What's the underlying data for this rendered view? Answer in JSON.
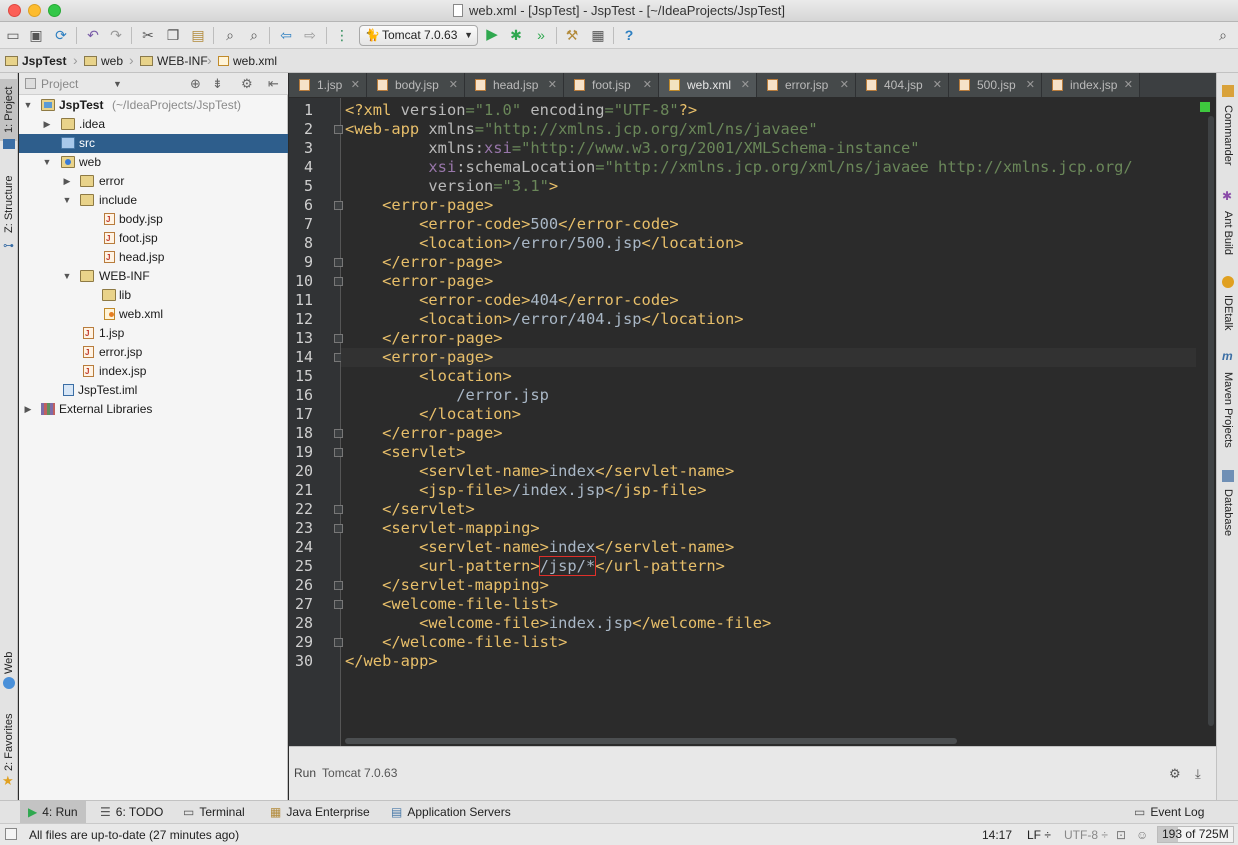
{
  "window": {
    "title": "web.xml - [JspTest] - JspTest - [~/IdeaProjects/JspTest]"
  },
  "toolbar": {
    "run_config": "Tomcat 7.0.63"
  },
  "breadcrumb": [
    "JspTest",
    "web",
    "WEB-INF",
    "web.xml"
  ],
  "left_strip": {
    "project_tab": "1: Project",
    "structure_tab": "Z: Structure",
    "web_tab": "Web",
    "favorites_tab": "2: Favorites"
  },
  "project_panel": {
    "view_selector": "Project",
    "tree": [
      {
        "label": "JspTest",
        "extra": "(~/IdeaProjects/JspTest)"
      },
      {
        "label": ".idea"
      },
      {
        "label": "src"
      },
      {
        "label": "web"
      },
      {
        "label": "error"
      },
      {
        "label": "include"
      },
      {
        "label": "body.jsp"
      },
      {
        "label": "foot.jsp"
      },
      {
        "label": "head.jsp"
      },
      {
        "label": "WEB-INF"
      },
      {
        "label": "lib"
      },
      {
        "label": "web.xml"
      },
      {
        "label": "1.jsp"
      },
      {
        "label": "error.jsp"
      },
      {
        "label": "index.jsp"
      },
      {
        "label": "JspTest.iml"
      },
      {
        "label": "External Libraries"
      }
    ]
  },
  "editor_tabs": [
    "1.jsp",
    "body.jsp",
    "head.jsp",
    "foot.jsp",
    "web.xml",
    "error.jsp",
    "404.jsp",
    "500.jsp",
    "index.jsp"
  ],
  "active_tab": "web.xml",
  "right_strip": {
    "commander": "Commander",
    "ant_build": "Ant Build",
    "idetalk": "IDEtalk",
    "maven": "Maven Projects",
    "database": "Database"
  },
  "editor": {
    "line_numbers": [
      "1",
      "2",
      "3",
      "4",
      "5",
      "6",
      "7",
      "8",
      "9",
      "10",
      "11",
      "12",
      "13",
      "14",
      "15",
      "16",
      "17",
      "18",
      "19",
      "20",
      "21",
      "22",
      "23",
      "24",
      "25",
      "26",
      "27",
      "28",
      "29",
      "30"
    ]
  },
  "run_panel": {
    "title": "Run",
    "config": "Tomcat 7.0.63"
  },
  "bottom_bar": {
    "run": "4: Run",
    "todo": "6: TODO",
    "terminal": "Terminal",
    "java_enterprise": "Java Enterprise",
    "app_servers": "Application Servers",
    "event_log": "Event Log"
  },
  "status_bar": {
    "message": "All files are up-to-date (27 minutes ago)",
    "position": "14:17",
    "line_sep": "LF ÷",
    "encoding": "UTF-8 ÷",
    "memory": "193 of 725M",
    "memory_used_fraction": 0.27
  },
  "colors": {
    "editor_bg": "#2b2b2b",
    "tag": "#e8bf6a",
    "attr_value": "#6a8759",
    "namespace": "#9876aa",
    "selection": "#2e5e8c"
  }
}
